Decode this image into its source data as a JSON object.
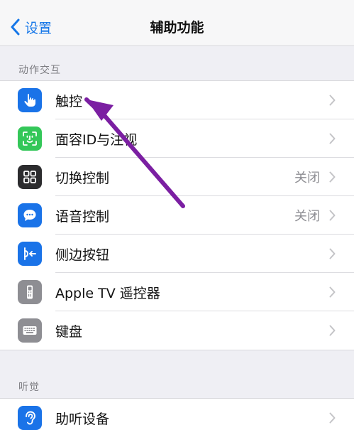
{
  "navbar": {
    "back_label": "设置",
    "title": "辅助功能"
  },
  "sections": [
    {
      "header": "动作交互",
      "items": [
        {
          "label": "触控",
          "value": "",
          "icon": "hand-tap-icon",
          "color": "#1a73e8"
        },
        {
          "label": "面容ID与注视",
          "value": "",
          "icon": "face-id-icon",
          "color": "#34c759"
        },
        {
          "label": "切换控制",
          "value": "关闭",
          "icon": "switch-control-icon",
          "color": "#2c2c2e"
        },
        {
          "label": "语音控制",
          "value": "关闭",
          "icon": "voice-control-icon",
          "color": "#1a73e8"
        },
        {
          "label": "侧边按钮",
          "value": "",
          "icon": "side-button-icon",
          "color": "#1a73e8"
        },
        {
          "label": "Apple TV 遥控器",
          "value": "",
          "icon": "tv-remote-icon",
          "color": "#8e8e93"
        },
        {
          "label": "键盘",
          "value": "",
          "icon": "keyboard-icon",
          "color": "#8e8e93"
        }
      ]
    },
    {
      "header": "听觉",
      "items": [
        {
          "label": "助听设备",
          "value": "",
          "icon": "ear-icon",
          "color": "#1a73e8"
        }
      ]
    }
  ],
  "annotation": {
    "arrow_color": "#7b1fa2",
    "icon": "annotation-arrow"
  }
}
